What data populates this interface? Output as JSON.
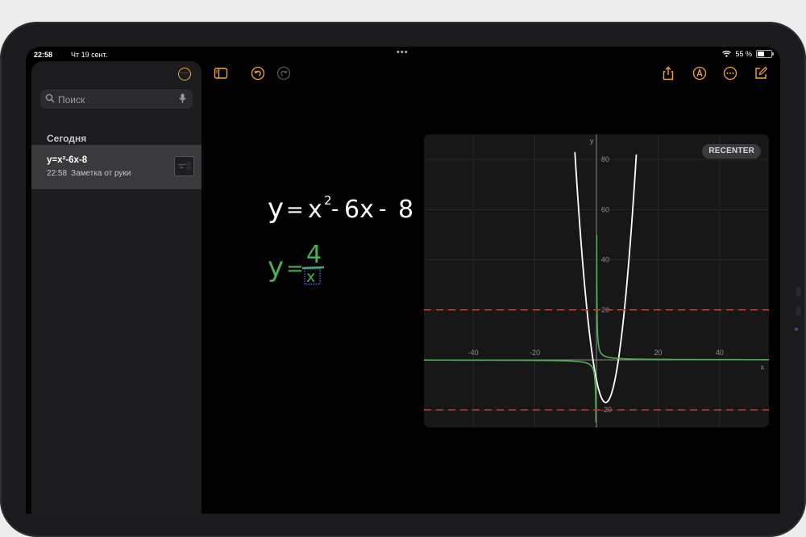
{
  "status": {
    "time": "22:58",
    "date": "Чт 19 сент.",
    "battery": "55 %",
    "battery_level": 0.55
  },
  "sidebar": {
    "search_placeholder": "Поиск",
    "section_title": "Сегодня",
    "notes": [
      {
        "title": "y=x²-6x-8",
        "time": "22:58",
        "subtitle": "Заметка от руки"
      }
    ]
  },
  "toolbar": {
    "icons": [
      "sidebar-toggle-icon",
      "undo-icon",
      "redo-icon",
      "share-icon",
      "markup-icon",
      "more-icon",
      "compose-icon"
    ],
    "accent": "#f5a623"
  },
  "canvas": {
    "equation": [
      "y",
      "=",
      "x",
      "2",
      "-",
      "6x",
      "-",
      "8"
    ],
    "result": [
      "y",
      "=",
      "4",
      "x"
    ],
    "ink_white": "#ffffff",
    "ink_green": "#4caf50"
  },
  "graph": {
    "recenter_label": "RECENTER"
  },
  "chart_data": {
    "type": "line",
    "xlabel": "x",
    "ylabel": "y",
    "xlim": [
      -56,
      56
    ],
    "ylim": [
      -27,
      90
    ],
    "x_ticks": [
      -40,
      -20,
      20,
      40
    ],
    "y_ticks": [
      20,
      40,
      60,
      80,
      -20
    ],
    "grid": true,
    "series": [
      {
        "type": "function",
        "expr": "x^2-6x-8",
        "color": "#ffffff"
      },
      {
        "type": "function",
        "expr": "4/x",
        "color": "#4caf50"
      },
      {
        "type": "hline",
        "y": 20,
        "style": "dashed",
        "color": "#c0392b"
      },
      {
        "type": "hline",
        "y": -20,
        "style": "dashed",
        "color": "#c0392b"
      }
    ]
  }
}
